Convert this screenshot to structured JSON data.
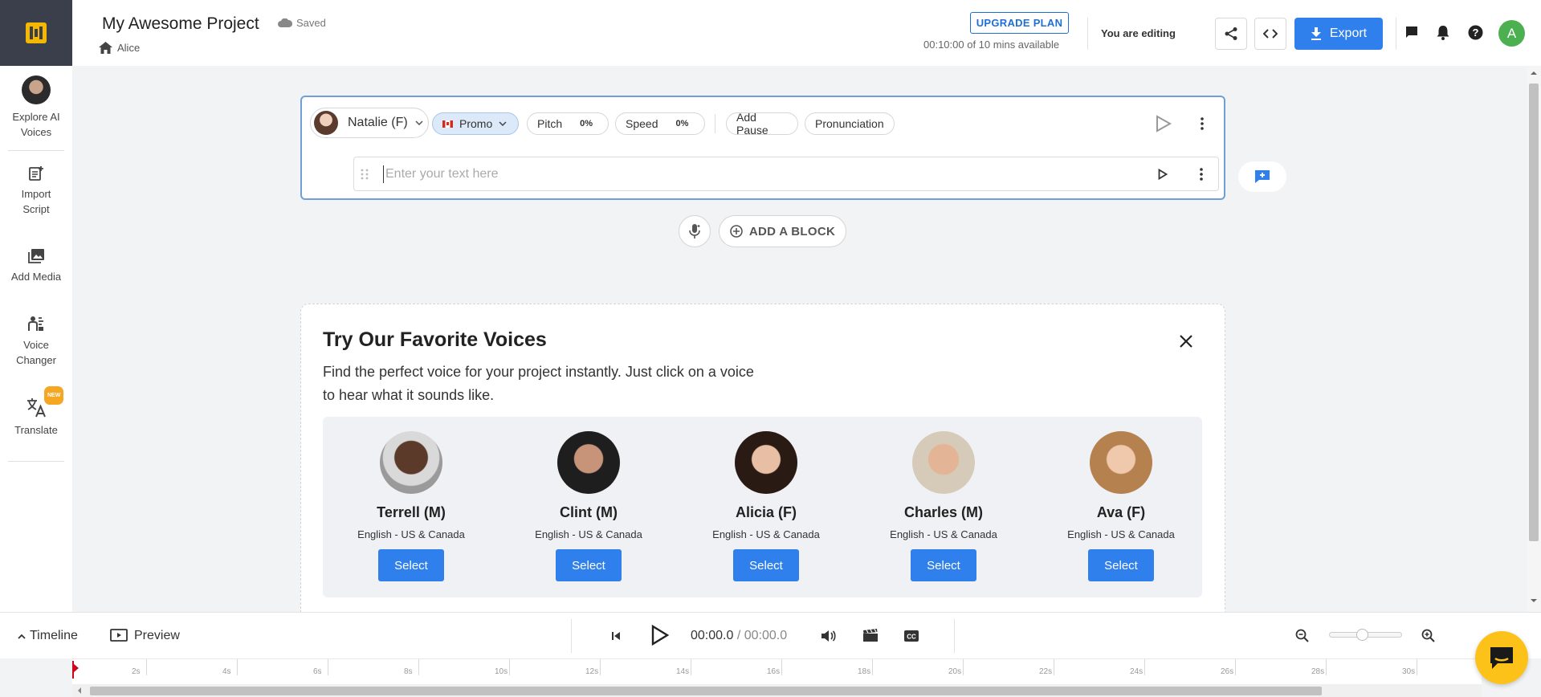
{
  "header": {
    "project_title": "My Awesome Project",
    "saved_label": "Saved",
    "breadcrumb_user": "Alice",
    "upgrade_label": "UPGRADE PLAN",
    "minutes_available": "00:10:00 of 10 mins available",
    "editing_status": "You are editing",
    "export_label": "Export",
    "avatar_initial": "A"
  },
  "sidebar": {
    "items": [
      {
        "label": "Explore AI Voices",
        "icon": "voice-avatar-icon"
      },
      {
        "label": "Import Script",
        "icon": "import-script-icon"
      },
      {
        "label": "Add Media",
        "icon": "media-library-icon"
      },
      {
        "label": "Voice Changer",
        "icon": "voice-changer-icon"
      },
      {
        "label": "Translate",
        "icon": "translate-icon",
        "badge": "NEW"
      }
    ]
  },
  "editor": {
    "voice_name": "Natalie (F)",
    "style_label": "Promo",
    "pitch_label": "Pitch",
    "pitch_value": "0%",
    "speed_label": "Speed",
    "speed_value": "0%",
    "add_pause_label": "Add Pause",
    "pronunciation_label": "Pronunciation",
    "text_placeholder": "Enter your text here",
    "add_block_label": "ADD A BLOCK"
  },
  "favorites": {
    "title": "Try Our Favorite Voices",
    "description": "Find the perfect voice for your project instantly. Just click on a voice to hear what it sounds like.",
    "select_label": "Select",
    "voices": [
      {
        "name": "Terrell (M)",
        "language": "English - US & Canada"
      },
      {
        "name": "Clint (M)",
        "language": "English - US & Canada"
      },
      {
        "name": "Alicia (F)",
        "language": "English - US & Canada"
      },
      {
        "name": "Charles (M)",
        "language": "English - US & Canada"
      },
      {
        "name": "Ava (F)",
        "language": "English - US & Canada"
      }
    ]
  },
  "bottom_bar": {
    "timeline_label": "Timeline",
    "preview_label": "Preview",
    "current_time": "00:00.0",
    "separator": "/",
    "duration": "00:00.0"
  },
  "timeline": {
    "ticks": [
      "2s",
      "4s",
      "6s",
      "8s",
      "10s",
      "12s",
      "14s",
      "16s",
      "18s",
      "20s",
      "22s",
      "24s",
      "26s",
      "28s",
      "30s"
    ]
  },
  "colors": {
    "accent": "#2f80ed",
    "logo_bg": "#3a3f4b",
    "logo_fg": "#f5b800",
    "chat_fab": "#fdc21a",
    "avatar": "#4caf50"
  }
}
